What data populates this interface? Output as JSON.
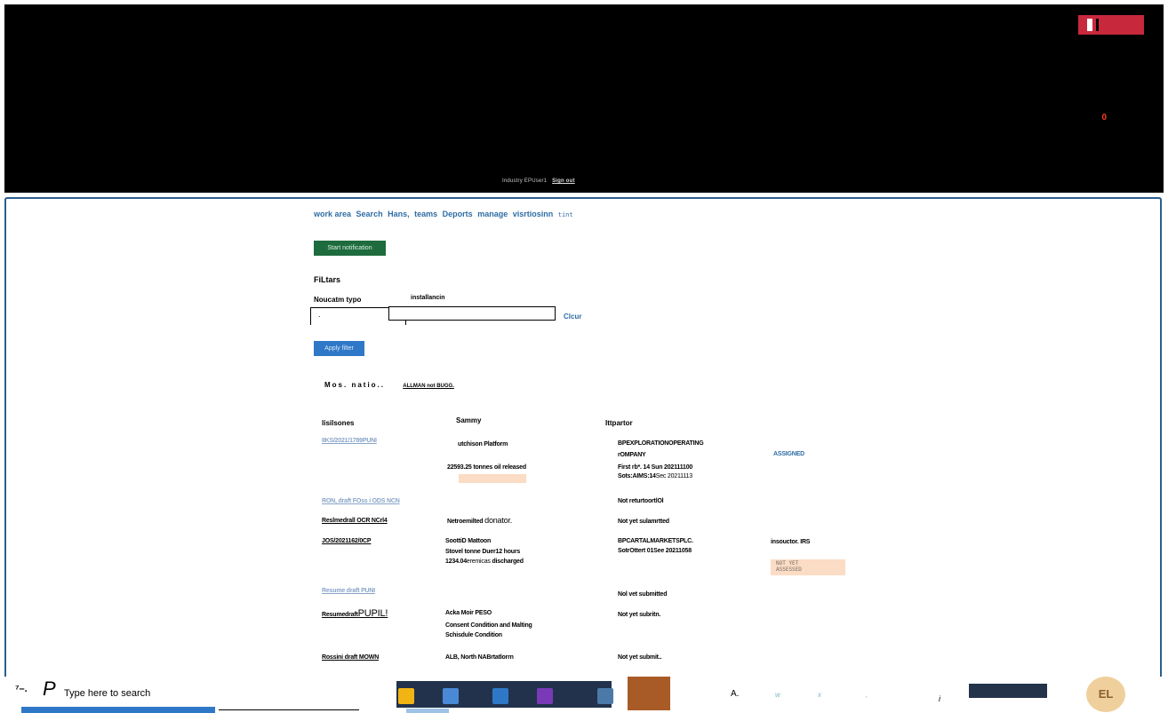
{
  "banner": {
    "alert_count": "0",
    "user_line": "Industry EPUser1",
    "sign_out": "Sign out"
  },
  "nav": {
    "items": [
      "work area",
      "Search",
      "Hans,",
      "teams",
      "Deports",
      "manage",
      "visrtiosinn"
    ],
    "suffix": "tint"
  },
  "actions": {
    "start_notification": "Start notification",
    "apply_filter": "Apply filter",
    "clear": "Clcur"
  },
  "filters": {
    "title": "FiLtars",
    "notification_type_label": "Noucatm typo",
    "notification_type_value": ".",
    "installation_label": "installancin",
    "installation_value": ""
  },
  "subtabs": {
    "active": "Mos. natio..",
    "other": "ALLMAN not BUGG."
  },
  "table": {
    "headers": [
      "lisilsones",
      "Sammy",
      "Ittpartor"
    ],
    "rows": {
      "r1": {
        "id": "IIKS/2021/1789PUNI",
        "summary1": "utchison Platform",
        "summary2": "22593.25 tonnes oil released",
        "operator1": "BPEXPLORATIONOPERATING",
        "operator2": "rOMPANY",
        "dates1": "First rb*. 14 Sun 202111100",
        "dates2_a": "Sots:AIMS:14",
        "dates2_b": "Sec 20211113",
        "status": "ASSIGNED"
      },
      "r2": {
        "id": "RON, draft FOss i ODS NCN",
        "operator": "Not returtoortlOl"
      },
      "r3": {
        "id": "Reslmedrall OCR NCrl4",
        "summary_a": "Netroemilted",
        "summary_b": "donator.",
        "operator": "Not yet sulamrtted"
      },
      "r4": {
        "id": "JOS/2021162/0CP",
        "summary1": "SoottiD Mattoon",
        "summary2": "Stovel tonne Duer12 hours",
        "summary3_a": "1234.04",
        "summary3_b": "eremicas",
        "summary3_c": "discharged",
        "operator1": "BPCARTALMARKETSPLC.",
        "operator2": "SotrOttert 01See 20211058",
        "assignee": "insouctor. IRS",
        "badge1": "NOT YET",
        "badge2": "ASSESSED"
      },
      "r5": {
        "id": "Resume draft PUNI",
        "operator": "Nol vet submitted"
      },
      "r6": {
        "id_a": "Resumedraft",
        "id_b": "PUPIL!",
        "summary1": "Acka Moir PESO",
        "summary2": "Consent Condition and Malting",
        "summary3": "Schisdule Condition",
        "operator": "Not yet subritn."
      },
      "r7": {
        "id": "Rossini draft MOWN",
        "summary": "ALB, North NABrtatlorrn",
        "operator": "Not yet submit.."
      }
    }
  },
  "taskbar": {
    "logo": "⁷–.",
    "search_icon_glyph": "P",
    "search_placeholder": "Type here to search",
    "a_label": "A.",
    "glyphs": [
      "w",
      "x",
      ",",
      "i"
    ],
    "avatar_initials": "EL"
  },
  "colors": {
    "banner": "#000000",
    "accent_blue": "#2e6da4",
    "primary_button": "#2f78c7",
    "start_button": "#1e6b3e",
    "badge_bg": "#fbdcc4",
    "flag_red": "#c8283c"
  }
}
